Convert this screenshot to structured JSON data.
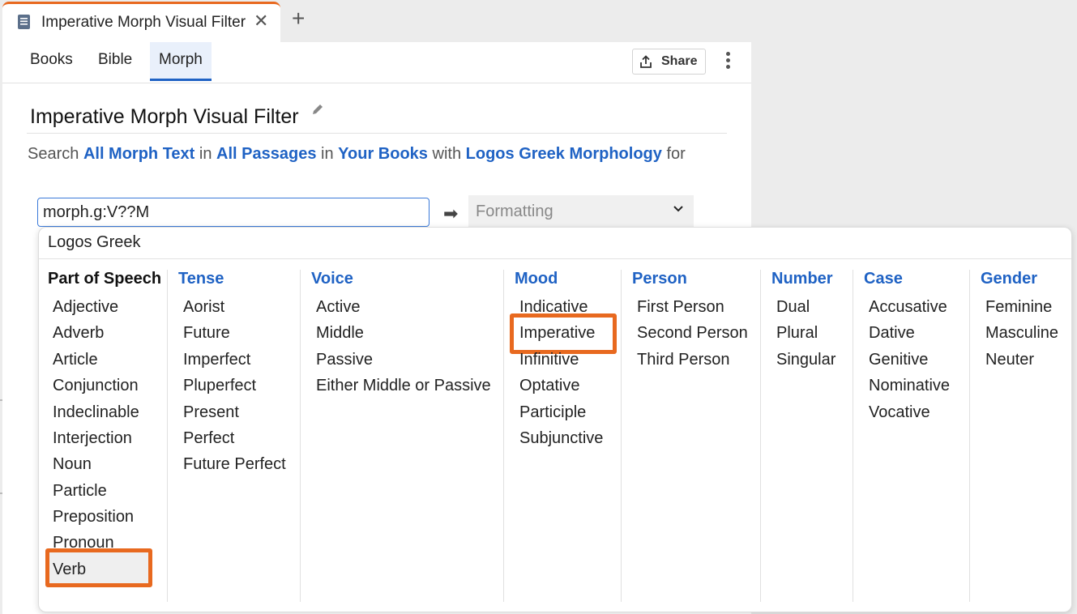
{
  "tab": {
    "title": "Imperative Morph Visual Filter",
    "close": "✕",
    "new_tab": "+"
  },
  "nav": {
    "tabs": [
      "Books",
      "Bible",
      "Morph"
    ],
    "active": "Morph",
    "share_label": "Share"
  },
  "doc": {
    "title": "Imperative Morph Visual Filter"
  },
  "search_line": {
    "w1": "Search",
    "l1": "All Morph Text",
    "w2": "in",
    "l2": "All Passages",
    "w3": "in",
    "l3": "Your Books",
    "w4": "with",
    "l4": "Logos Greek Morphology",
    "w5": "for"
  },
  "query": {
    "value": "morph.g:V??M"
  },
  "format_select": {
    "label": "Formatting"
  },
  "dropdown": {
    "header": "Logos Greek",
    "columns": [
      {
        "head": "Part of Speech",
        "items": [
          "Adjective",
          "Adverb",
          "Article",
          "Conjunction",
          "Indeclinable",
          "Interjection",
          "Noun",
          "Particle",
          "Preposition",
          "Pronoun",
          "Verb"
        ]
      },
      {
        "head": "Tense",
        "items": [
          "Aorist",
          "Future",
          "Imperfect",
          "Pluperfect",
          "Present",
          "Perfect",
          "Future Perfect"
        ]
      },
      {
        "head": "Voice",
        "items": [
          "Active",
          "Middle",
          "Passive",
          "Either Middle or Passive"
        ]
      },
      {
        "head": "Mood",
        "items": [
          "Indicative",
          "Imperative",
          "Infinitive",
          "Optative",
          "Participle",
          "Subjunctive"
        ]
      },
      {
        "head": "Person",
        "items": [
          "First Person",
          "Second Person",
          "Third Person"
        ]
      },
      {
        "head": "Number",
        "items": [
          "Dual",
          "Plural",
          "Singular"
        ]
      },
      {
        "head": "Case",
        "items": [
          "Accusative",
          "Dative",
          "Genitive",
          "Nominative",
          "Vocative"
        ]
      },
      {
        "head": "Gender",
        "items": [
          "Feminine",
          "Masculine",
          "Neuter"
        ]
      }
    ],
    "selected": [
      "Verb",
      "Imperative"
    ]
  },
  "colors": {
    "accent": "#e8691f",
    "link": "#1f62c4",
    "active_tab_bg": "#e9f0fb"
  }
}
